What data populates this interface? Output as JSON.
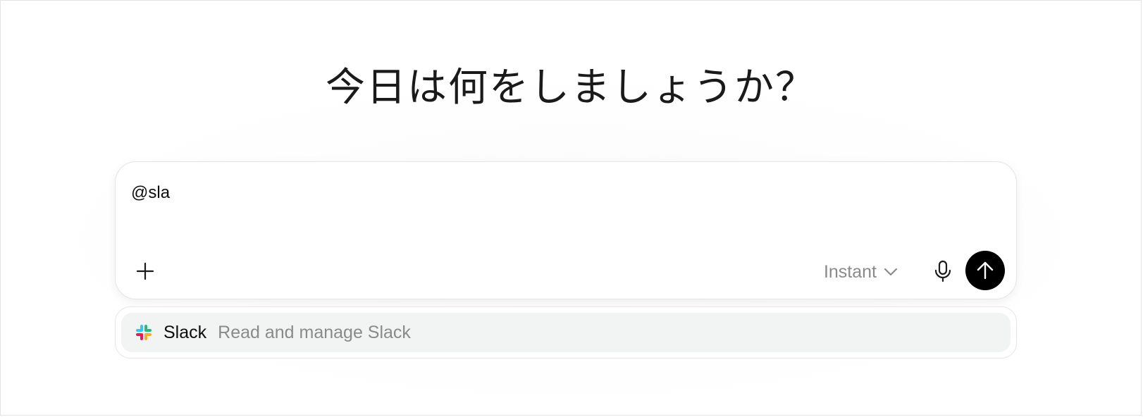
{
  "heading": "今日は何をしましょうか？",
  "composer": {
    "input_value": "@sla",
    "model_label": "Instant",
    "icons": {
      "add": "plus-icon",
      "model_dropdown": "chevron-down-icon",
      "mic": "microphone-icon",
      "send": "arrow-up-icon"
    }
  },
  "mention_popup": {
    "items": [
      {
        "icon": "slack-logo",
        "name": "Slack",
        "description": "Read and manage Slack"
      }
    ]
  },
  "colors": {
    "send_button": "#000000",
    "popup_item_bg": "#f2f3f3",
    "muted_text": "#8a8a8a",
    "slack_red": "#E01E5A",
    "slack_blue": "#36C5F0",
    "slack_green": "#2EB67D",
    "slack_yellow": "#ECB22E"
  }
}
